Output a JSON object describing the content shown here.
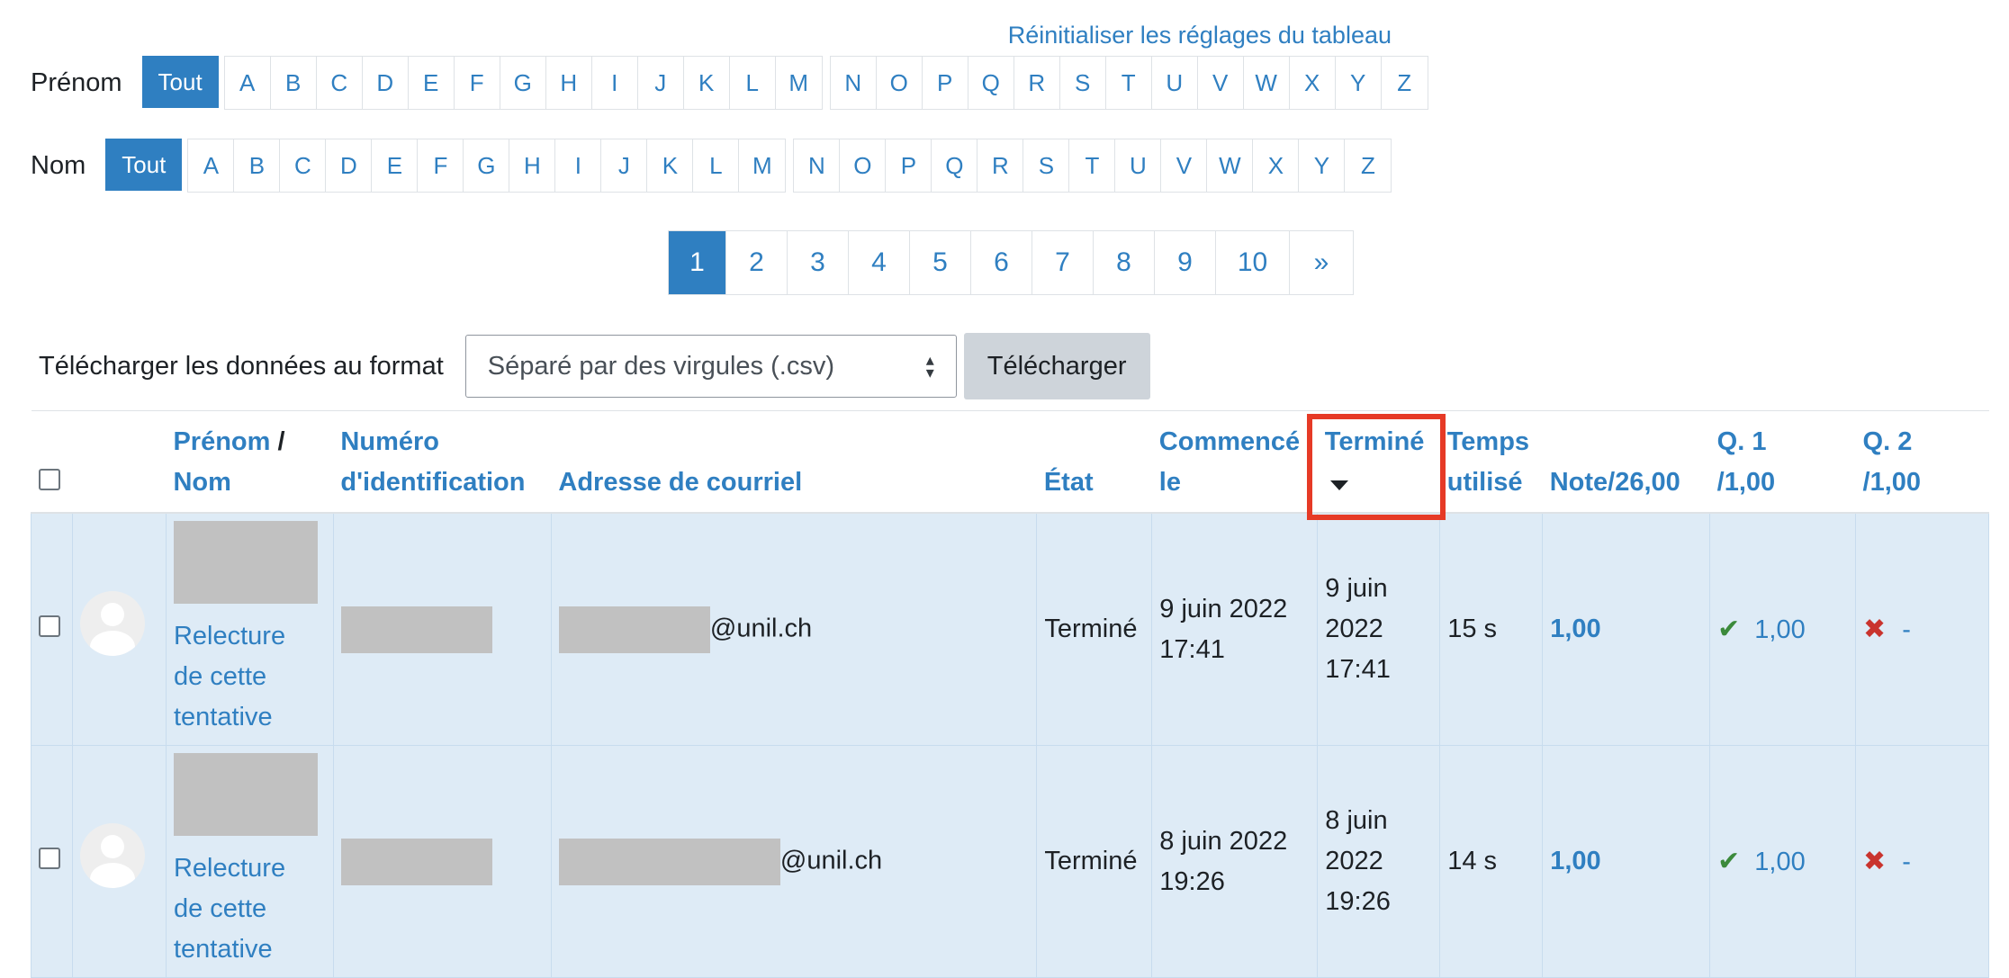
{
  "reset_link": "Réinitialiser les réglages du tableau",
  "firstname_filter": {
    "label": "Prénom",
    "all": "Tout",
    "group1": [
      "A",
      "B",
      "C",
      "D",
      "E",
      "F",
      "G",
      "H",
      "I",
      "J",
      "K",
      "L",
      "M"
    ],
    "group2": [
      "N",
      "O",
      "P",
      "Q",
      "R",
      "S",
      "T",
      "U",
      "V",
      "W",
      "X",
      "Y",
      "Z"
    ]
  },
  "lastname_filter": {
    "label": "Nom",
    "all": "Tout",
    "group1": [
      "A",
      "B",
      "C",
      "D",
      "E",
      "F",
      "G",
      "H",
      "I",
      "J",
      "K",
      "L",
      "M"
    ],
    "group2": [
      "N",
      "O",
      "P",
      "Q",
      "R",
      "S",
      "T",
      "U",
      "V",
      "W",
      "X",
      "Y",
      "Z"
    ]
  },
  "pagination": {
    "pages": [
      "1",
      "2",
      "3",
      "4",
      "5",
      "6",
      "7",
      "8",
      "9",
      "10"
    ],
    "current": "1",
    "next": "»"
  },
  "download": {
    "label": "Télécharger les données au format",
    "selected_format": "Séparé par des virgules (.csv)",
    "button": "Télécharger"
  },
  "table": {
    "headers": {
      "firstname": "Prénom",
      "separator": " / ",
      "lastname": "Nom",
      "idnumber_1": "Numéro",
      "idnumber_2": "d'identification",
      "email": "Adresse de courriel",
      "state": "État",
      "started_1": "Commencé",
      "started_2": "le",
      "finished": "Terminé",
      "duration_1": "Temps",
      "duration_2": "utilisé",
      "grade": "Note/26,00",
      "q1_1": "Q. 1",
      "q1_2": "/1,00",
      "q2_1": "Q. 2",
      "q2_2": "/1,00"
    },
    "rows": [
      {
        "review_1": "Relecture",
        "review_2": "de cette",
        "review_3": "tentative",
        "email_domain": "@unil.ch",
        "state": "Terminé",
        "started_1": "9 juin 2022",
        "started_2": "17:41",
        "finished_1": "9 juin",
        "finished_2": "2022",
        "finished_3": "17:41",
        "duration": "15 s",
        "grade": "1,00",
        "q1": "1,00",
        "q2": "-"
      },
      {
        "review_1": "Relecture",
        "review_2": "de cette",
        "review_3": "tentative",
        "email_domain": "@unil.ch",
        "state": "Terminé",
        "started_1": "8 juin 2022",
        "started_2": "19:26",
        "finished_1": "8 juin",
        "finished_2": "2022",
        "finished_3": "19:26",
        "duration": "14 s",
        "grade": "1,00",
        "q1": "1,00",
        "q2": "-"
      }
    ]
  },
  "colors": {
    "accent": "#2f7fc1",
    "row_bg": "#deebf6",
    "highlight": "#e63a26",
    "correct": "#3b8a3b",
    "incorrect": "#c9342e"
  }
}
